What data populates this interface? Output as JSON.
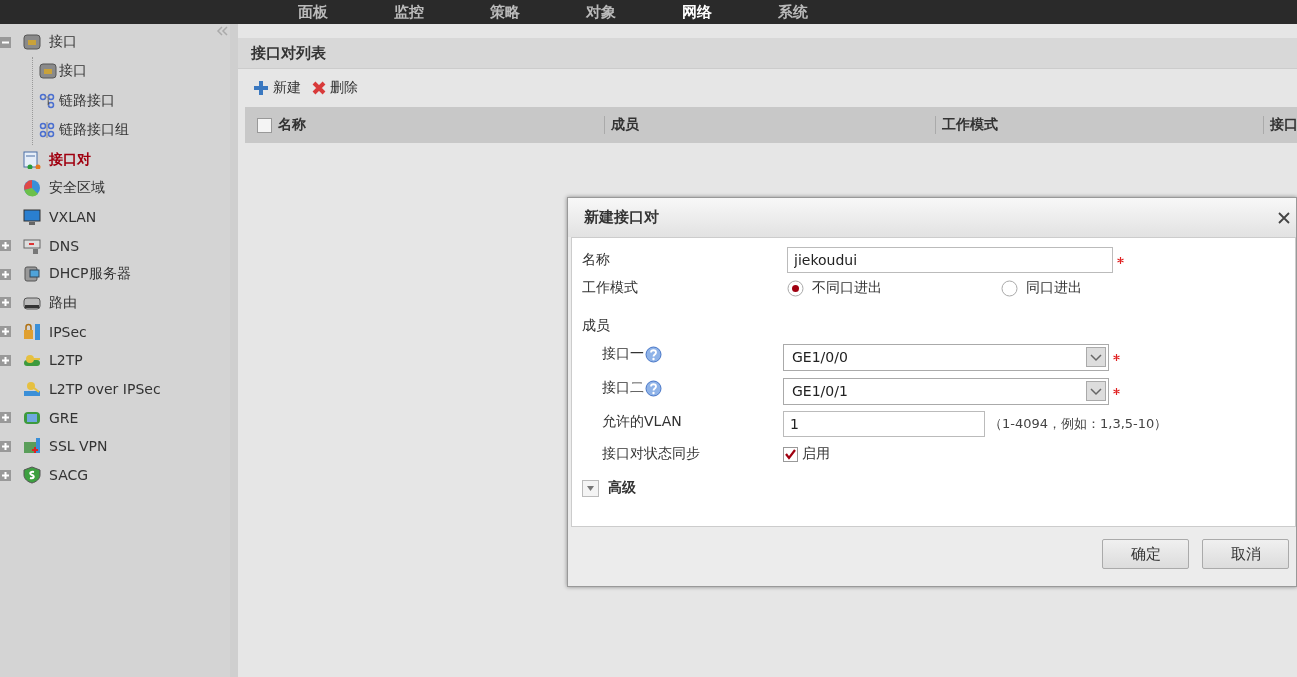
{
  "top_nav": [
    {
      "label": "面板",
      "selected": false
    },
    {
      "label": "监控",
      "selected": false
    },
    {
      "label": "策略",
      "selected": false
    },
    {
      "label": "对象",
      "selected": false
    },
    {
      "label": "网络",
      "selected": true
    },
    {
      "label": "系统",
      "selected": false
    }
  ],
  "sidebar": {
    "items": [
      {
        "label": "接口",
        "kind": "group",
        "expanded": true,
        "selected": false,
        "children": [
          {
            "label": "接口",
            "selected": false
          },
          {
            "label": "链路接口",
            "selected": false
          },
          {
            "label": "链路接口组",
            "selected": false
          }
        ]
      },
      {
        "label": "接口对",
        "kind": "leaf",
        "selected": true
      },
      {
        "label": "安全区域",
        "kind": "leaf",
        "selected": false
      },
      {
        "label": "VXLAN",
        "kind": "leaf",
        "selected": false
      },
      {
        "label": "DNS",
        "kind": "group",
        "expanded": false,
        "selected": false
      },
      {
        "label": "DHCP服务器",
        "kind": "group",
        "expanded": false,
        "selected": false
      },
      {
        "label": "路由",
        "kind": "group",
        "expanded": false,
        "selected": false
      },
      {
        "label": "IPSec",
        "kind": "group",
        "expanded": false,
        "selected": false
      },
      {
        "label": "L2TP",
        "kind": "group",
        "expanded": false,
        "selected": false
      },
      {
        "label": "L2TP over IPSec",
        "kind": "leaf",
        "selected": false
      },
      {
        "label": "GRE",
        "kind": "group",
        "expanded": false,
        "selected": false
      },
      {
        "label": "SSL VPN",
        "kind": "group",
        "expanded": false,
        "selected": false
      },
      {
        "label": "SACG",
        "kind": "group",
        "expanded": false,
        "selected": false
      }
    ]
  },
  "panel": {
    "title": "接口对列表",
    "toolbar": [
      {
        "label": "新建",
        "kind": "add"
      },
      {
        "label": "删除",
        "kind": "delete"
      }
    ],
    "table": {
      "select_all": {
        "checked": false
      },
      "columns": [
        "名称",
        "成员",
        "工作模式",
        "接口"
      ]
    }
  },
  "dialog": {
    "title": "新建接口对",
    "name": {
      "label": "名称",
      "value": "jiekoudui",
      "required": true
    },
    "mode": {
      "label": "工作模式",
      "options": [
        {
          "label": "不同口进出",
          "selected": true
        },
        {
          "label": "同口进出",
          "selected": false
        }
      ]
    },
    "members_label": "成员",
    "interfaces": [
      {
        "label": "接口一",
        "value": "GE1/0/0",
        "required": true
      },
      {
        "label": "接口二",
        "value": "GE1/0/1",
        "required": true
      }
    ],
    "vlan": {
      "label": "允许的VLAN",
      "value": "1",
      "hint": "（1-4094，例如：1,3,5-10）"
    },
    "sync": {
      "label": "接口对状态同步",
      "checkbox_label": "启用",
      "checked": true
    },
    "advanced": {
      "label": "高级",
      "expanded": false
    },
    "buttons": [
      "确定",
      "取消"
    ]
  }
}
